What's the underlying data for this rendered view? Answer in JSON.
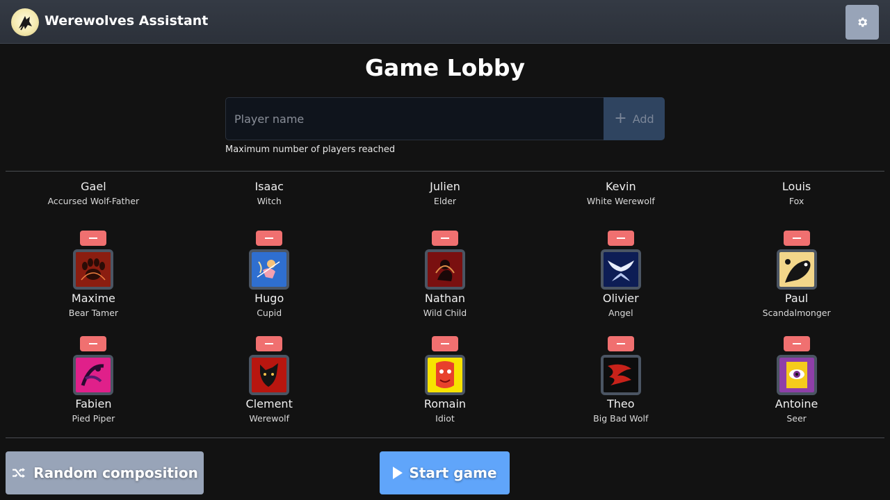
{
  "header": {
    "app_title": "Werewolves Assistant",
    "logo_icon": "wolf-logo-icon",
    "settings_icon": "gear-icon"
  },
  "lobby": {
    "title": "Game Lobby",
    "player_input_placeholder": "Player name",
    "player_input_value": "",
    "add_label": "Add",
    "max_message": "Maximum number of players reached"
  },
  "players": [
    {
      "name": "Gael",
      "role": "Accursed Wolf-Father",
      "icon": "paw-icon"
    },
    {
      "name": "Isaac",
      "role": "Witch",
      "icon": "witch-icon"
    },
    {
      "name": "Julien",
      "role": "Elder",
      "icon": "elder-icon"
    },
    {
      "name": "Kevin",
      "role": "White Werewolf",
      "icon": "white-werewolf-icon"
    },
    {
      "name": "Louis",
      "role": "Fox",
      "icon": "fox-icon"
    },
    {
      "name": "Maxime",
      "role": "Bear Tamer",
      "icon": "bear-paw-icon"
    },
    {
      "name": "Hugo",
      "role": "Cupid",
      "icon": "cupid-icon"
    },
    {
      "name": "Nathan",
      "role": "Wild Child",
      "icon": "wild-child-icon"
    },
    {
      "name": "Olivier",
      "role": "Angel",
      "icon": "angel-wings-icon"
    },
    {
      "name": "Paul",
      "role": "Scandalmonger",
      "icon": "crow-icon"
    },
    {
      "name": "Fabien",
      "role": "Pied Piper",
      "icon": "pied-piper-icon"
    },
    {
      "name": "Clement",
      "role": "Werewolf",
      "icon": "werewolf-icon"
    },
    {
      "name": "Romain",
      "role": "Idiot",
      "icon": "idiot-icon"
    },
    {
      "name": "Theo",
      "role": "Big Bad Wolf",
      "icon": "big-bad-wolf-icon"
    },
    {
      "name": "Antoine",
      "role": "Seer",
      "icon": "seer-eye-icon"
    }
  ],
  "actions": {
    "random_label": "Random composition",
    "random_icon": "shuffle-icon",
    "start_label": "Start game",
    "start_icon": "play-icon"
  },
  "colors": {
    "background": "#121212",
    "header": "#343a44",
    "remove_button": "#f07070",
    "start_button": "#60a5fa",
    "secondary_button": "#98a4b8"
  }
}
